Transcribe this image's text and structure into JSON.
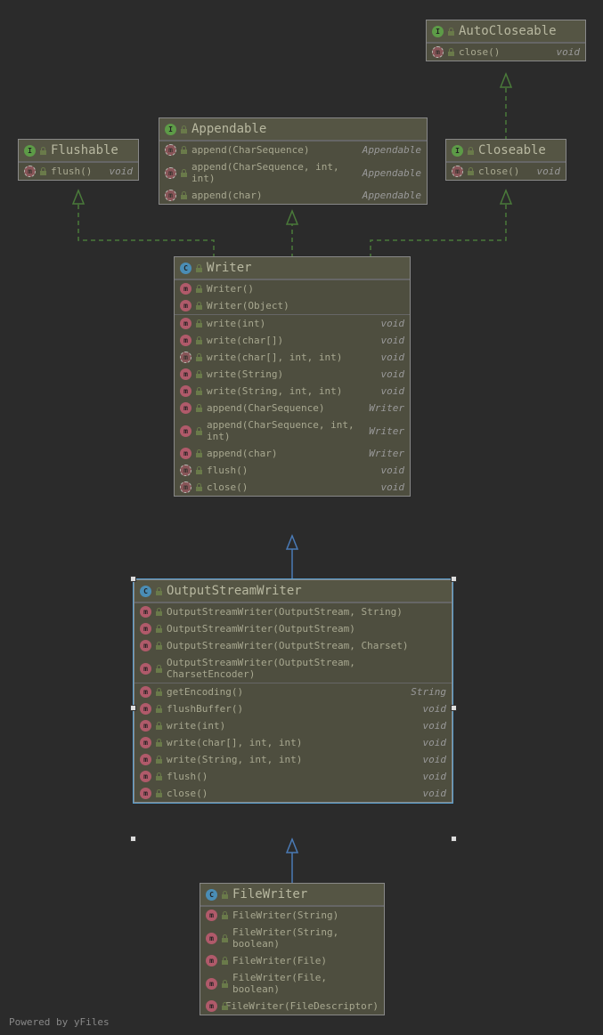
{
  "footer": "Powered by yFiles",
  "classes": {
    "autocloseable": {
      "type": "interface",
      "name": "AutoCloseable",
      "members": [
        {
          "kind": "method-abs",
          "sig": "close()",
          "ret": "void"
        }
      ]
    },
    "flushable": {
      "type": "interface",
      "name": "Flushable",
      "members": [
        {
          "kind": "method-abs",
          "sig": "flush()",
          "ret": "void"
        }
      ]
    },
    "appendable": {
      "type": "interface",
      "name": "Appendable",
      "members": [
        {
          "kind": "method-abs",
          "sig": "append(CharSequence)",
          "ret": "Appendable"
        },
        {
          "kind": "method-abs",
          "sig": "append(CharSequence, int, int)",
          "ret": "Appendable"
        },
        {
          "kind": "method-abs",
          "sig": "append(char)",
          "ret": "Appendable"
        }
      ]
    },
    "closeable": {
      "type": "interface",
      "name": "Closeable",
      "members": [
        {
          "kind": "method-abs",
          "sig": "close()",
          "ret": "void"
        }
      ]
    },
    "writer": {
      "type": "class-abstract",
      "name": "Writer",
      "ctors": [
        {
          "kind": "method",
          "sig": "Writer()",
          "ret": ""
        },
        {
          "kind": "method",
          "sig": "Writer(Object)",
          "ret": ""
        }
      ],
      "members": [
        {
          "kind": "method",
          "sig": "write(int)",
          "ret": "void"
        },
        {
          "kind": "method",
          "sig": "write(char[])",
          "ret": "void"
        },
        {
          "kind": "method-abs",
          "sig": "write(char[], int, int)",
          "ret": "void"
        },
        {
          "kind": "method",
          "sig": "write(String)",
          "ret": "void"
        },
        {
          "kind": "method",
          "sig": "write(String, int, int)",
          "ret": "void"
        },
        {
          "kind": "method",
          "sig": "append(CharSequence)",
          "ret": "Writer"
        },
        {
          "kind": "method",
          "sig": "append(CharSequence, int, int)",
          "ret": "Writer"
        },
        {
          "kind": "method",
          "sig": "append(char)",
          "ret": "Writer"
        },
        {
          "kind": "method-abs",
          "sig": "flush()",
          "ret": "void"
        },
        {
          "kind": "method-abs",
          "sig": "close()",
          "ret": "void"
        }
      ]
    },
    "outputstreamwriter": {
      "type": "class",
      "name": "OutputStreamWriter",
      "ctors": [
        {
          "kind": "method",
          "sig": "OutputStreamWriter(OutputStream, String)",
          "ret": ""
        },
        {
          "kind": "method",
          "sig": "OutputStreamWriter(OutputStream)",
          "ret": ""
        },
        {
          "kind": "method",
          "sig": "OutputStreamWriter(OutputStream, Charset)",
          "ret": ""
        },
        {
          "kind": "method",
          "sig": "OutputStreamWriter(OutputStream, CharsetEncoder)",
          "ret": ""
        }
      ],
      "members": [
        {
          "kind": "method",
          "sig": "getEncoding()",
          "ret": "String"
        },
        {
          "kind": "method",
          "sig": "flushBuffer()",
          "ret": "void"
        },
        {
          "kind": "method",
          "sig": "write(int)",
          "ret": "void"
        },
        {
          "kind": "method",
          "sig": "write(char[], int, int)",
          "ret": "void"
        },
        {
          "kind": "method",
          "sig": "write(String, int, int)",
          "ret": "void"
        },
        {
          "kind": "method",
          "sig": "flush()",
          "ret": "void"
        },
        {
          "kind": "method",
          "sig": "close()",
          "ret": "void"
        }
      ]
    },
    "filewriter": {
      "type": "class",
      "name": "FileWriter",
      "ctors": [
        {
          "kind": "method",
          "sig": "FileWriter(String)",
          "ret": ""
        },
        {
          "kind": "method",
          "sig": "FileWriter(String, boolean)",
          "ret": ""
        },
        {
          "kind": "method",
          "sig": "FileWriter(File)",
          "ret": ""
        },
        {
          "kind": "method",
          "sig": "FileWriter(File, boolean)",
          "ret": ""
        },
        {
          "kind": "method",
          "sig": "FileWriter(FileDescriptor)",
          "ret": ""
        }
      ],
      "members": []
    }
  }
}
